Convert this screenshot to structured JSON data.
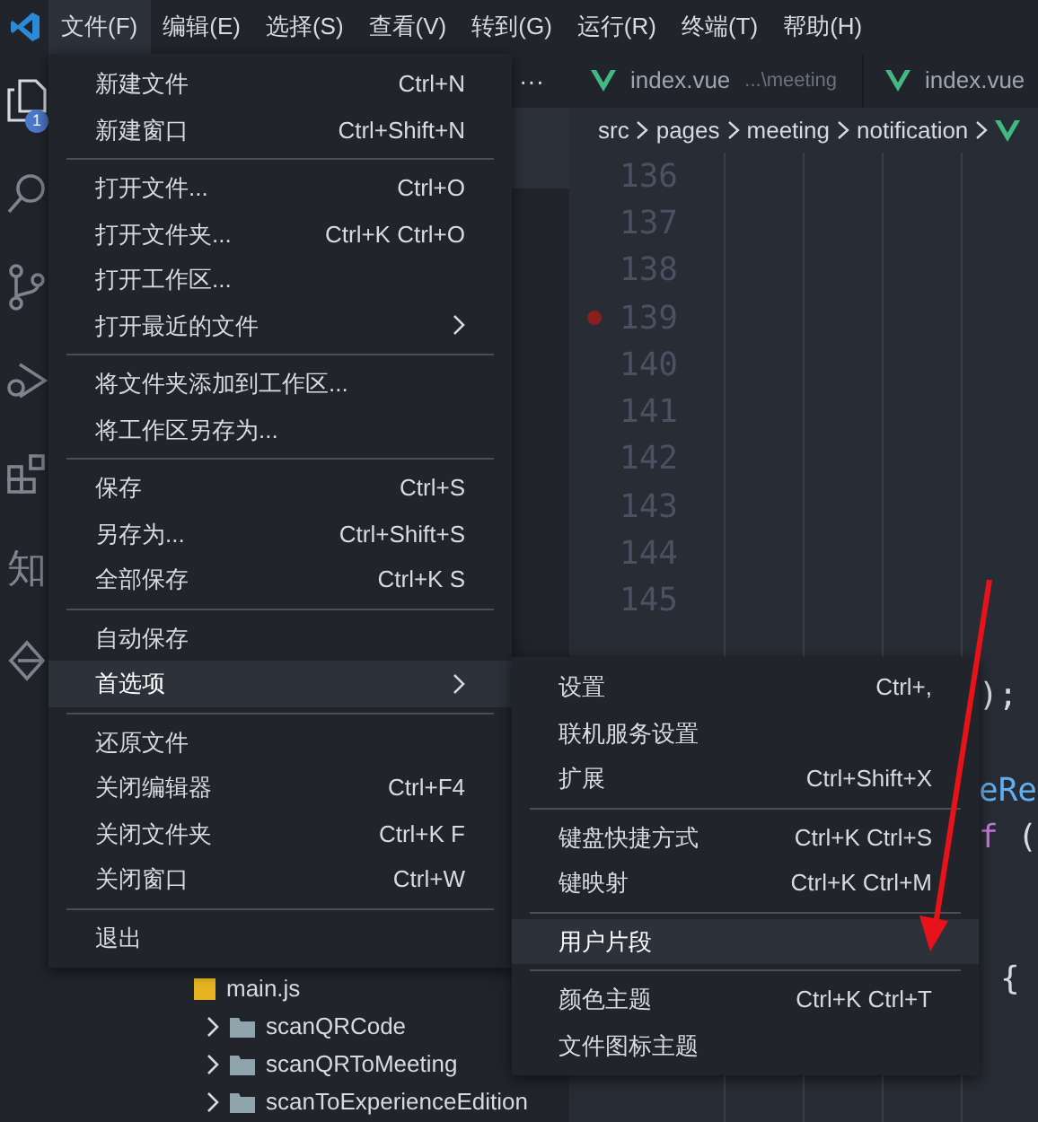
{
  "menubar": {
    "items": [
      {
        "label": "文件(F)",
        "selected": true
      },
      {
        "label": "编辑(E)",
        "selected": false
      },
      {
        "label": "选择(S)",
        "selected": false
      },
      {
        "label": "查看(V)",
        "selected": false
      },
      {
        "label": "转到(G)",
        "selected": false
      },
      {
        "label": "运行(R)",
        "selected": false
      },
      {
        "label": "终端(T)",
        "selected": false
      },
      {
        "label": "帮助(H)",
        "selected": false
      }
    ]
  },
  "activity_bar": {
    "items": [
      {
        "kind": "files",
        "badge": "1"
      },
      {
        "kind": "search"
      },
      {
        "kind": "source-control"
      },
      {
        "kind": "debug"
      },
      {
        "kind": "extensions"
      },
      {
        "kind": "text",
        "label": "知"
      },
      {
        "kind": "diamond"
      }
    ]
  },
  "tabs": {
    "more": "···",
    "items": [
      {
        "name": "index.vue",
        "description": "...\\meeting"
      },
      {
        "name": "index.vue"
      }
    ]
  },
  "breadcrumb": [
    "src",
    "pages",
    "meeting",
    "notification"
  ],
  "editor": {
    "lines": [
      {
        "number": "136",
        "breakpoint": false
      },
      {
        "number": "137",
        "breakpoint": false
      },
      {
        "number": "138",
        "breakpoint": false
      },
      {
        "number": "139",
        "breakpoint": true
      },
      {
        "number": "140",
        "breakpoint": false
      },
      {
        "number": "141",
        "breakpoint": false
      },
      {
        "number": "142",
        "breakpoint": false
      },
      {
        "number": "143",
        "breakpoint": false
      },
      {
        "number": "144",
        "breakpoint": false
      },
      {
        "number": "145",
        "breakpoint": false
      }
    ],
    "code_fragments": [
      {
        "tokens": [
          {
            "kind": "plain",
            "text": ");"
          }
        ]
      },
      {
        "tokens": [
          {
            "kind": "function",
            "text": "eRe"
          }
        ]
      },
      {
        "tokens": [
          {
            "kind": "keyword",
            "text": "f"
          },
          {
            "kind": "plain",
            "text": " ("
          }
        ]
      },
      {
        "tokens": [
          {
            "kind": "plain",
            "text": "{"
          }
        ]
      }
    ]
  },
  "explorer": {
    "items": [
      {
        "kind": "file",
        "name": "main.js"
      },
      {
        "kind": "folder",
        "name": "scanQRCode"
      },
      {
        "kind": "folder",
        "name": "scanQRToMeeting"
      },
      {
        "kind": "folder",
        "name": "scanToExperienceEdition"
      }
    ]
  },
  "file_menu": {
    "groups": [
      [
        {
          "label": "新建文件",
          "shortcut": "Ctrl+N"
        },
        {
          "label": "新建窗口",
          "shortcut": "Ctrl+Shift+N"
        }
      ],
      [
        {
          "label": "打开文件...",
          "shortcut": "Ctrl+O"
        },
        {
          "label": "打开文件夹...",
          "shortcut": "Ctrl+K Ctrl+O"
        },
        {
          "label": "打开工作区..."
        },
        {
          "label": "打开最近的文件",
          "submenu": true
        }
      ],
      [
        {
          "label": "将文件夹添加到工作区..."
        },
        {
          "label": "将工作区另存为..."
        }
      ],
      [
        {
          "label": "保存",
          "shortcut": "Ctrl+S"
        },
        {
          "label": "另存为...",
          "shortcut": "Ctrl+Shift+S"
        },
        {
          "label": "全部保存",
          "shortcut": "Ctrl+K S"
        }
      ],
      [
        {
          "label": "自动保存"
        },
        {
          "label": "首选项",
          "submenu": true,
          "selected": true
        }
      ],
      [
        {
          "label": "还原文件"
        },
        {
          "label": "关闭编辑器",
          "shortcut": "Ctrl+F4"
        },
        {
          "label": "关闭文件夹",
          "shortcut": "Ctrl+K F"
        },
        {
          "label": "关闭窗口",
          "shortcut": "Ctrl+W"
        }
      ],
      [
        {
          "label": "退出"
        }
      ]
    ]
  },
  "preferences_menu": {
    "groups": [
      [
        {
          "label": "设置",
          "shortcut": "Ctrl+,"
        },
        {
          "label": "联机服务设置"
        },
        {
          "label": "扩展",
          "shortcut": "Ctrl+Shift+X"
        }
      ],
      [
        {
          "label": "键盘快捷方式",
          "shortcut": "Ctrl+K Ctrl+S"
        },
        {
          "label": "键映射",
          "shortcut": "Ctrl+K Ctrl+M"
        }
      ],
      [
        {
          "label": "用户片段",
          "selected": true
        }
      ],
      [
        {
          "label": "颜色主题",
          "shortcut": "Ctrl+K Ctrl+T"
        },
        {
          "label": "文件图标主题"
        }
      ]
    ]
  },
  "annotation": {
    "kind": "arrow"
  }
}
